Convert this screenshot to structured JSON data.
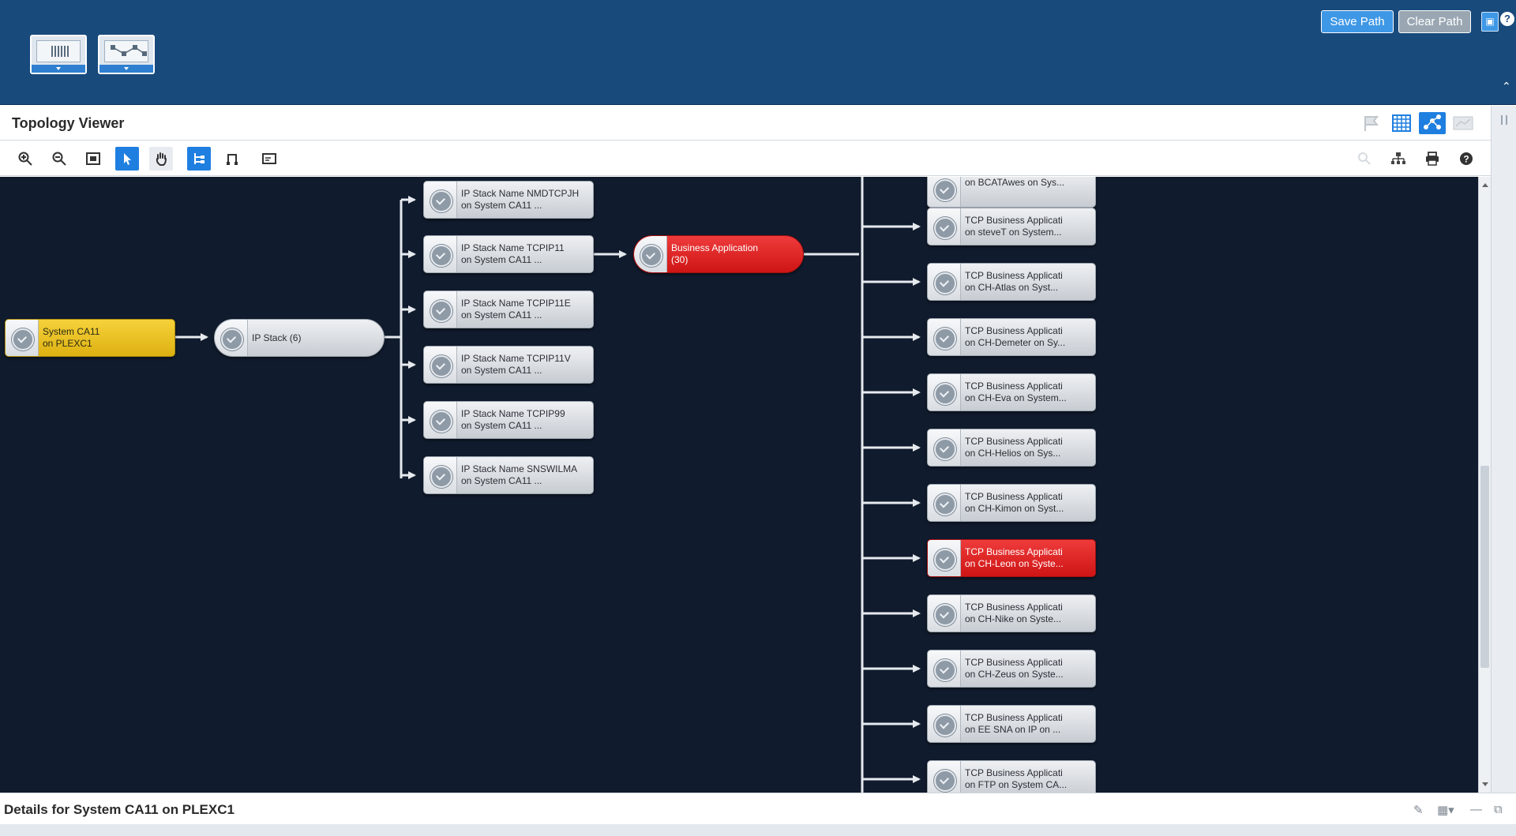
{
  "header": {
    "save_path": "Save Path",
    "clear_path": "Clear Path",
    "help": "?"
  },
  "viewer": {
    "title": "Topology Viewer"
  },
  "nodes": {
    "system": {
      "line1": "System CA11",
      "line2": "on PLEXC1",
      "status": "warning"
    },
    "ipstack": {
      "line1": "IP Stack (6)",
      "line2": ""
    },
    "stacks": [
      {
        "line1": "IP Stack Name NMDTCPJH",
        "line2": "on System CA11 ..."
      },
      {
        "line1": "IP Stack Name TCPIP11",
        "line2": "on System CA11 ..."
      },
      {
        "line1": "IP Stack Name TCPIP11E",
        "line2": "on System CA11 ..."
      },
      {
        "line1": "IP Stack Name TCPIP11V",
        "line2": "on System CA11 ..."
      },
      {
        "line1": "IP Stack Name TCPIP99",
        "line2": "on System CA11 ..."
      },
      {
        "line1": "IP Stack Name SNSWILMA",
        "line2": "on System CA11 ..."
      }
    ],
    "business": {
      "line1": "Business Application",
      "line2": "(30)",
      "status": "critical"
    },
    "apps": [
      {
        "line1": "",
        "line2": "on BCATAwes on Sys...",
        "status": "normal"
      },
      {
        "line1": "TCP Business Applicati",
        "line2": "on steveT on System...",
        "status": "normal"
      },
      {
        "line1": "TCP Business Applicati",
        "line2": "on CH-Atlas on Syst...",
        "status": "normal"
      },
      {
        "line1": "TCP Business Applicati",
        "line2": "on CH-Demeter on Sy...",
        "status": "normal"
      },
      {
        "line1": "TCP Business Applicati",
        "line2": "on CH-Eva on System...",
        "status": "normal"
      },
      {
        "line1": "TCP Business Applicati",
        "line2": "on CH-Helios on Sys...",
        "status": "normal"
      },
      {
        "line1": "TCP Business Applicati",
        "line2": "on CH-Kimon on Syst...",
        "status": "normal"
      },
      {
        "line1": "TCP Business Applicati",
        "line2": "on CH-Leon on Syste...",
        "status": "critical"
      },
      {
        "line1": "TCP Business Applicati",
        "line2": "on CH-Nike on Syste...",
        "status": "normal"
      },
      {
        "line1": "TCP Business Applicati",
        "line2": "on CH-Zeus on Syste...",
        "status": "normal"
      },
      {
        "line1": "TCP Business Applicati",
        "line2": "on EE SNA on IP on ...",
        "status": "normal"
      },
      {
        "line1": "TCP Business Applicati",
        "line2": "on FTP on System CA...",
        "status": "normal"
      }
    ]
  },
  "details": {
    "title": "Details for System CA11 on PLEXC1"
  },
  "colors": {
    "header_bg": "#184a7c",
    "canvas_bg": "#101b2d",
    "accent": "#1f7fe0",
    "critical": "#e02222",
    "warning": "#f2c62c"
  },
  "icons": {
    "toolbar": [
      "zoom-in-icon",
      "zoom-out-icon",
      "fit-to-screen-icon",
      "select-pointer-icon",
      "pan-hand-icon",
      "tree-layout-icon",
      "orthogonal-layout-icon",
      "overview-icon"
    ],
    "toolbar_right": [
      "search-icon",
      "hierarchy-icon",
      "print-icon",
      "help-icon"
    ]
  }
}
